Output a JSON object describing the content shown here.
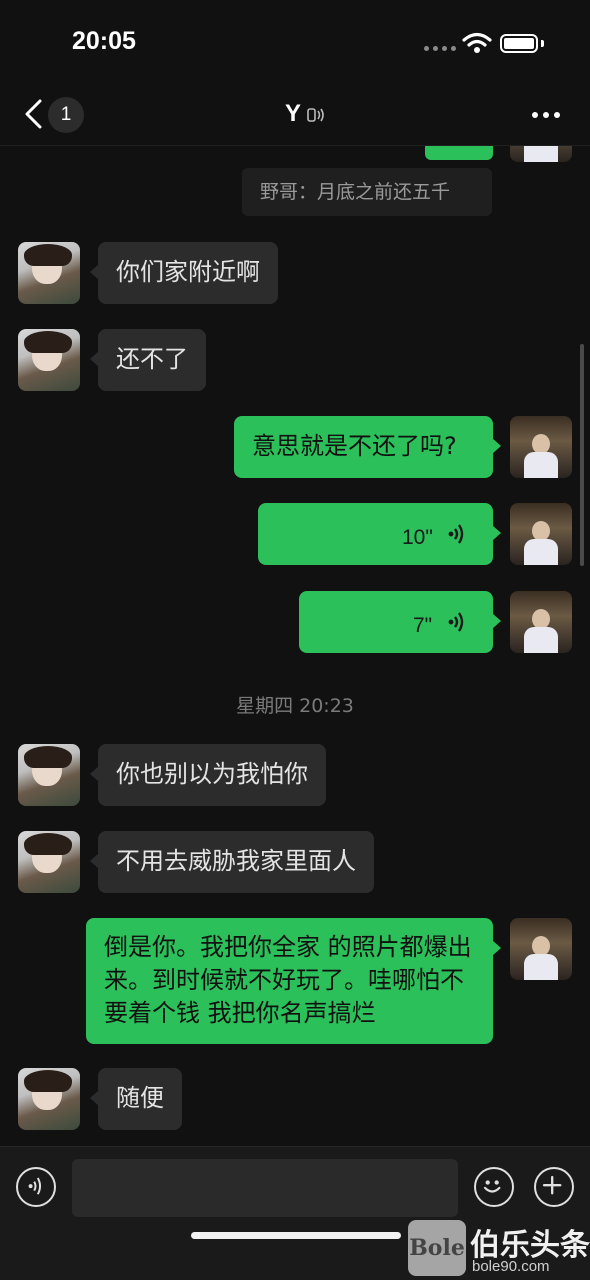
{
  "status_bar": {
    "time": "20:05"
  },
  "nav": {
    "unread_count": "1",
    "title": "Y"
  },
  "quoted": {
    "text": "野哥：月底之前还五千"
  },
  "messages": [
    {
      "side": "in",
      "text": "你们家附近啊"
    },
    {
      "side": "in",
      "text": "还不了"
    },
    {
      "side": "out",
      "text": "意思就是不还了吗?"
    },
    {
      "side": "out",
      "type": "voice",
      "duration": "10\""
    },
    {
      "side": "out",
      "type": "voice",
      "duration": "7\""
    },
    {
      "side": "in",
      "text": "你也别以为我怕你"
    },
    {
      "side": "in",
      "text": "不用去威胁我家里面人"
    },
    {
      "side": "out",
      "text": "倒是你。我把你全家 的照片都爆出来。到时候就不好玩了。哇哪怕不要着个钱 我把你名声搞烂"
    },
    {
      "side": "in",
      "text": "随便"
    }
  ],
  "time_divider": "星期四 20:23",
  "input": {
    "placeholder": "",
    "value": ""
  },
  "watermark": {
    "logo": "Bole",
    "title": "伯乐头条",
    "url": "bole90.com"
  },
  "colors": {
    "outgoing_bubble": "#2bc05a",
    "incoming_bubble": "#2c2c2c",
    "background": "#111111"
  },
  "icons": [
    "back-chevron-icon",
    "voice-mode-icon",
    "more-icon",
    "voice-wave-icon",
    "voice-toggle-icon",
    "emoji-icon",
    "plus-icon"
  ]
}
